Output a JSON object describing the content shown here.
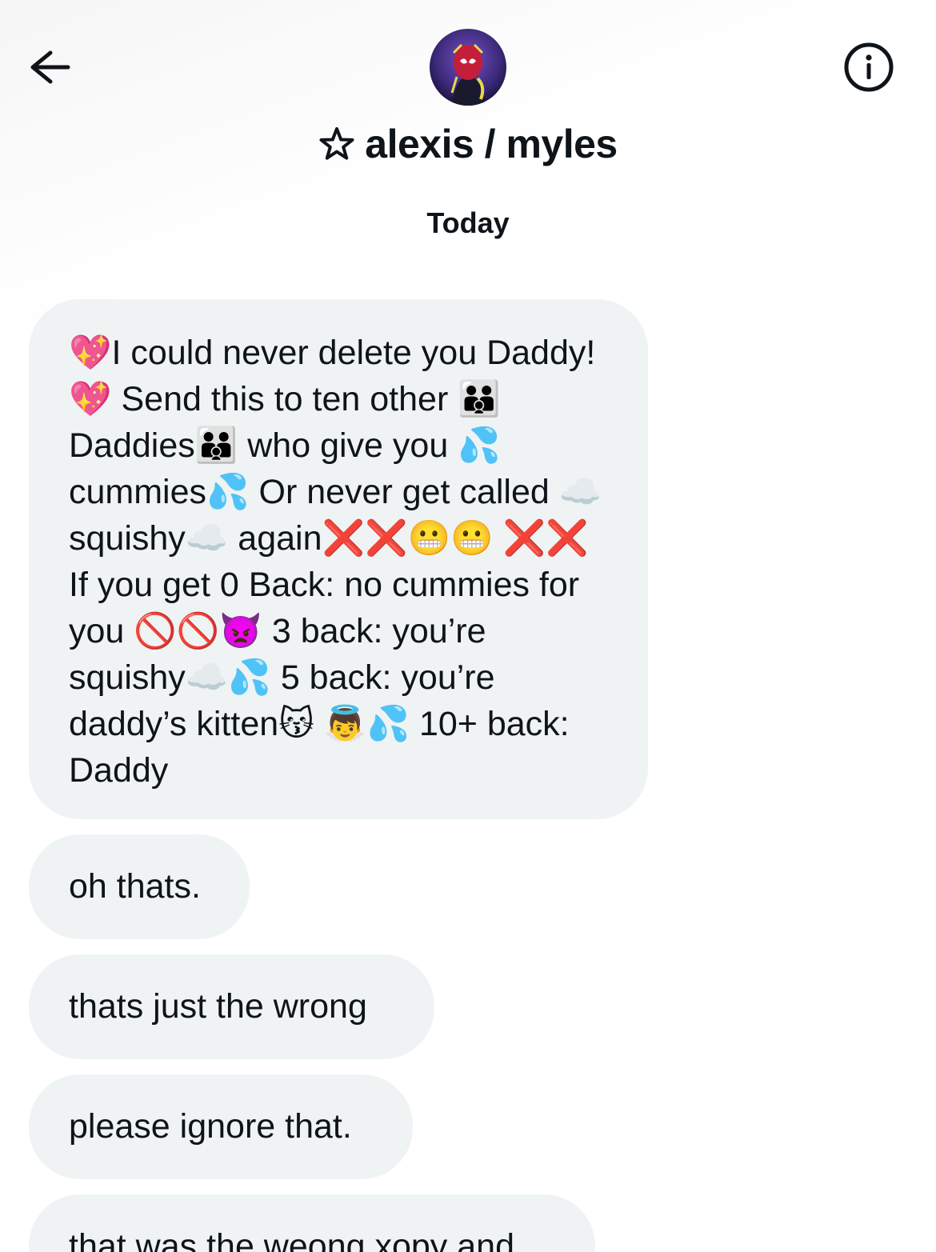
{
  "header": {
    "name": "alexis / myles",
    "date": "Today"
  },
  "icons": {
    "back": "arrow-left-icon",
    "info": "info-circle-icon",
    "star": "star-outline-icon",
    "avatar": "profile-avatar"
  },
  "colors": {
    "bubble_bg": "#eff3f4",
    "text": "#0f1419"
  },
  "messages": [
    {
      "text": "💖I could never delete you Daddy!💖 Send this to ten other 👨‍👨‍👦Daddies👨‍👨‍👦 who give you 💦 cummies💦 Or never get called ☁️squishy☁️ again❌❌😬😬 ❌❌ If you get 0 Back: no cummies for you 🚫🚫👿 3 back: you’re squishy☁️💦 5 back: you’re daddy’s kitten😽 👼💦 10+ back: Daddy"
    },
    {
      "text": "oh thats."
    },
    {
      "text": "thats just the wrong"
    },
    {
      "text": "please ignore that."
    },
    {
      "text": "that was the weong xopy and"
    }
  ]
}
